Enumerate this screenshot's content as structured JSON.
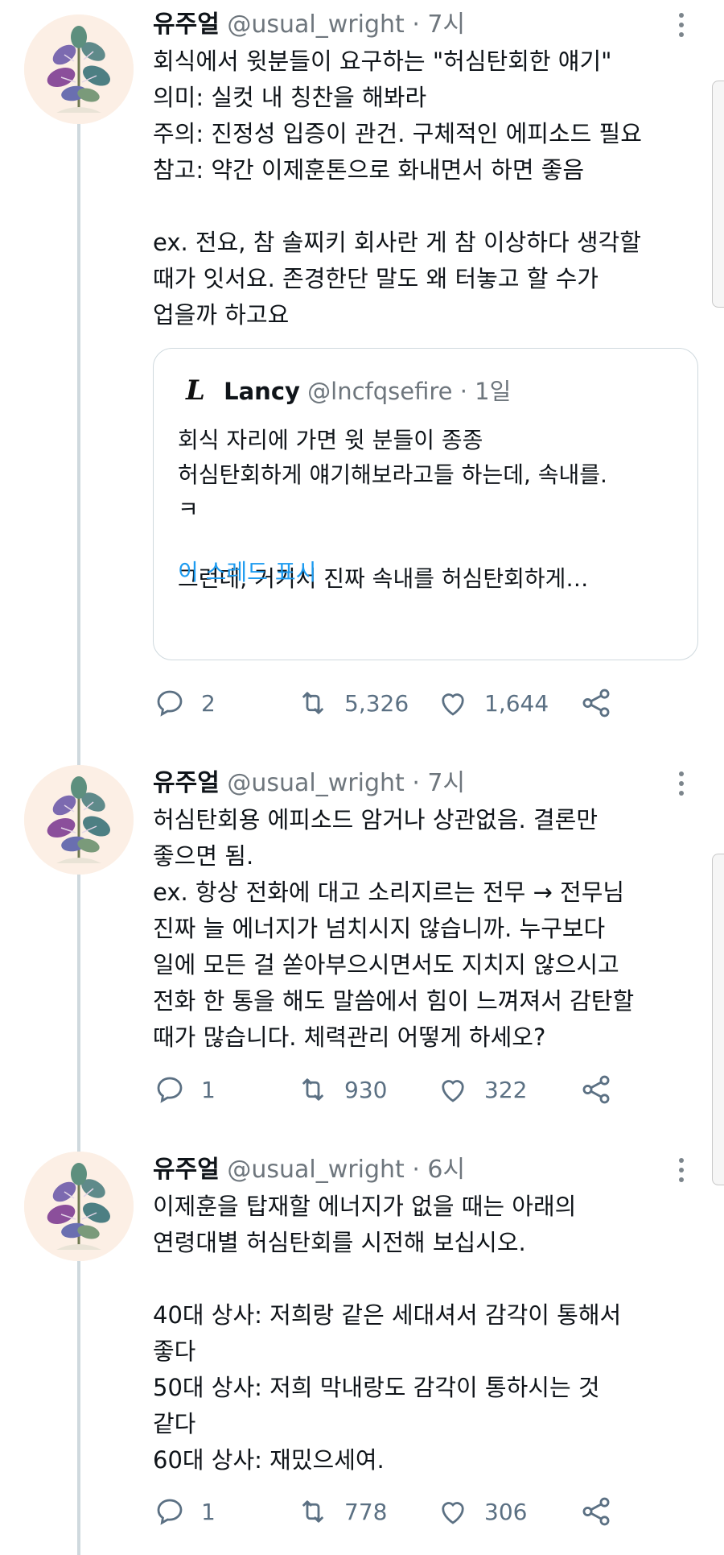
{
  "tweets": [
    {
      "name": "유주얼",
      "handle": "@usual_wright",
      "time": "· 7시",
      "text": "회식에서 윗분들이 요구하는 \"허심탄회한 얘기\"\n의미: 실컷 내 칭찬을 해봐라\n주의: 진정성 입증이 관건. 구체적인 에피소드 필요\n참고: 약간 이제훈톤으로 화내면서 하면 좋음\n\nex. 전요, 참 솔찌키 회사란 게 참 이상하다 생각할\n때가 잇서요. 존경한단 말도 왜 터놓고 할 수가\n업을까 하고요",
      "replies": "2",
      "retweets": "5,326",
      "likes": "1,644"
    },
    {
      "name": "유주얼",
      "handle": "@usual_wright",
      "time": "· 7시",
      "text": "허심탄회용 에피소드 암거나 상관없음. 결론만\n좋으면 됨.\nex. 항상 전화에 대고 소리지르는 전무 → 전무님\n진짜 늘 에너지가 넘치시지 않습니까. 누구보다\n일에 모든 걸 쏟아부으시면서도 지치지 않으시고\n전화 한 통을 해도 말씀에서 힘이 느껴져서 감탄할\n때가 많습니다. 체력관리 어떻게 하세오?",
      "replies": "1",
      "retweets": "930",
      "likes": "322"
    },
    {
      "name": "유주얼",
      "handle": "@usual_wright",
      "time": "· 6시",
      "text": "이제훈을 탑재할 에너지가 없을 때는 아래의\n연령대별 허심탄회를 시전해 보십시오.\n\n40대 상사: 저희랑 같은 세대셔서 감각이 통해서\n좋다\n50대 상사: 저희 막내랑도 감각이 통하시는 것\n같다\n60대 상사: 재밌으세여.",
      "replies": "1",
      "retweets": "778",
      "likes": "306"
    }
  ],
  "quote": {
    "logo": "L",
    "name": "Lancy",
    "handle": "@lncfqsefire",
    "time": "· 1일",
    "text": "회식 자리에 가면 윗 분들이 종종\n허심탄회하게 얘기해보라고들 하는데, 속내를.\nㅋ\n\n그런데, 거기서 진짜 속내를 허심탄회하게…",
    "link": "이 스레드 표시"
  },
  "icons": {
    "reply": "reply-icon",
    "retweet": "retweet-icon",
    "like": "heart-icon",
    "share": "share-icon",
    "more": "more-icon"
  },
  "colors": {
    "text": "#0f1419",
    "muted": "#6e767d",
    "link": "#1d9bf0",
    "thread_line": "#cfd9de"
  }
}
